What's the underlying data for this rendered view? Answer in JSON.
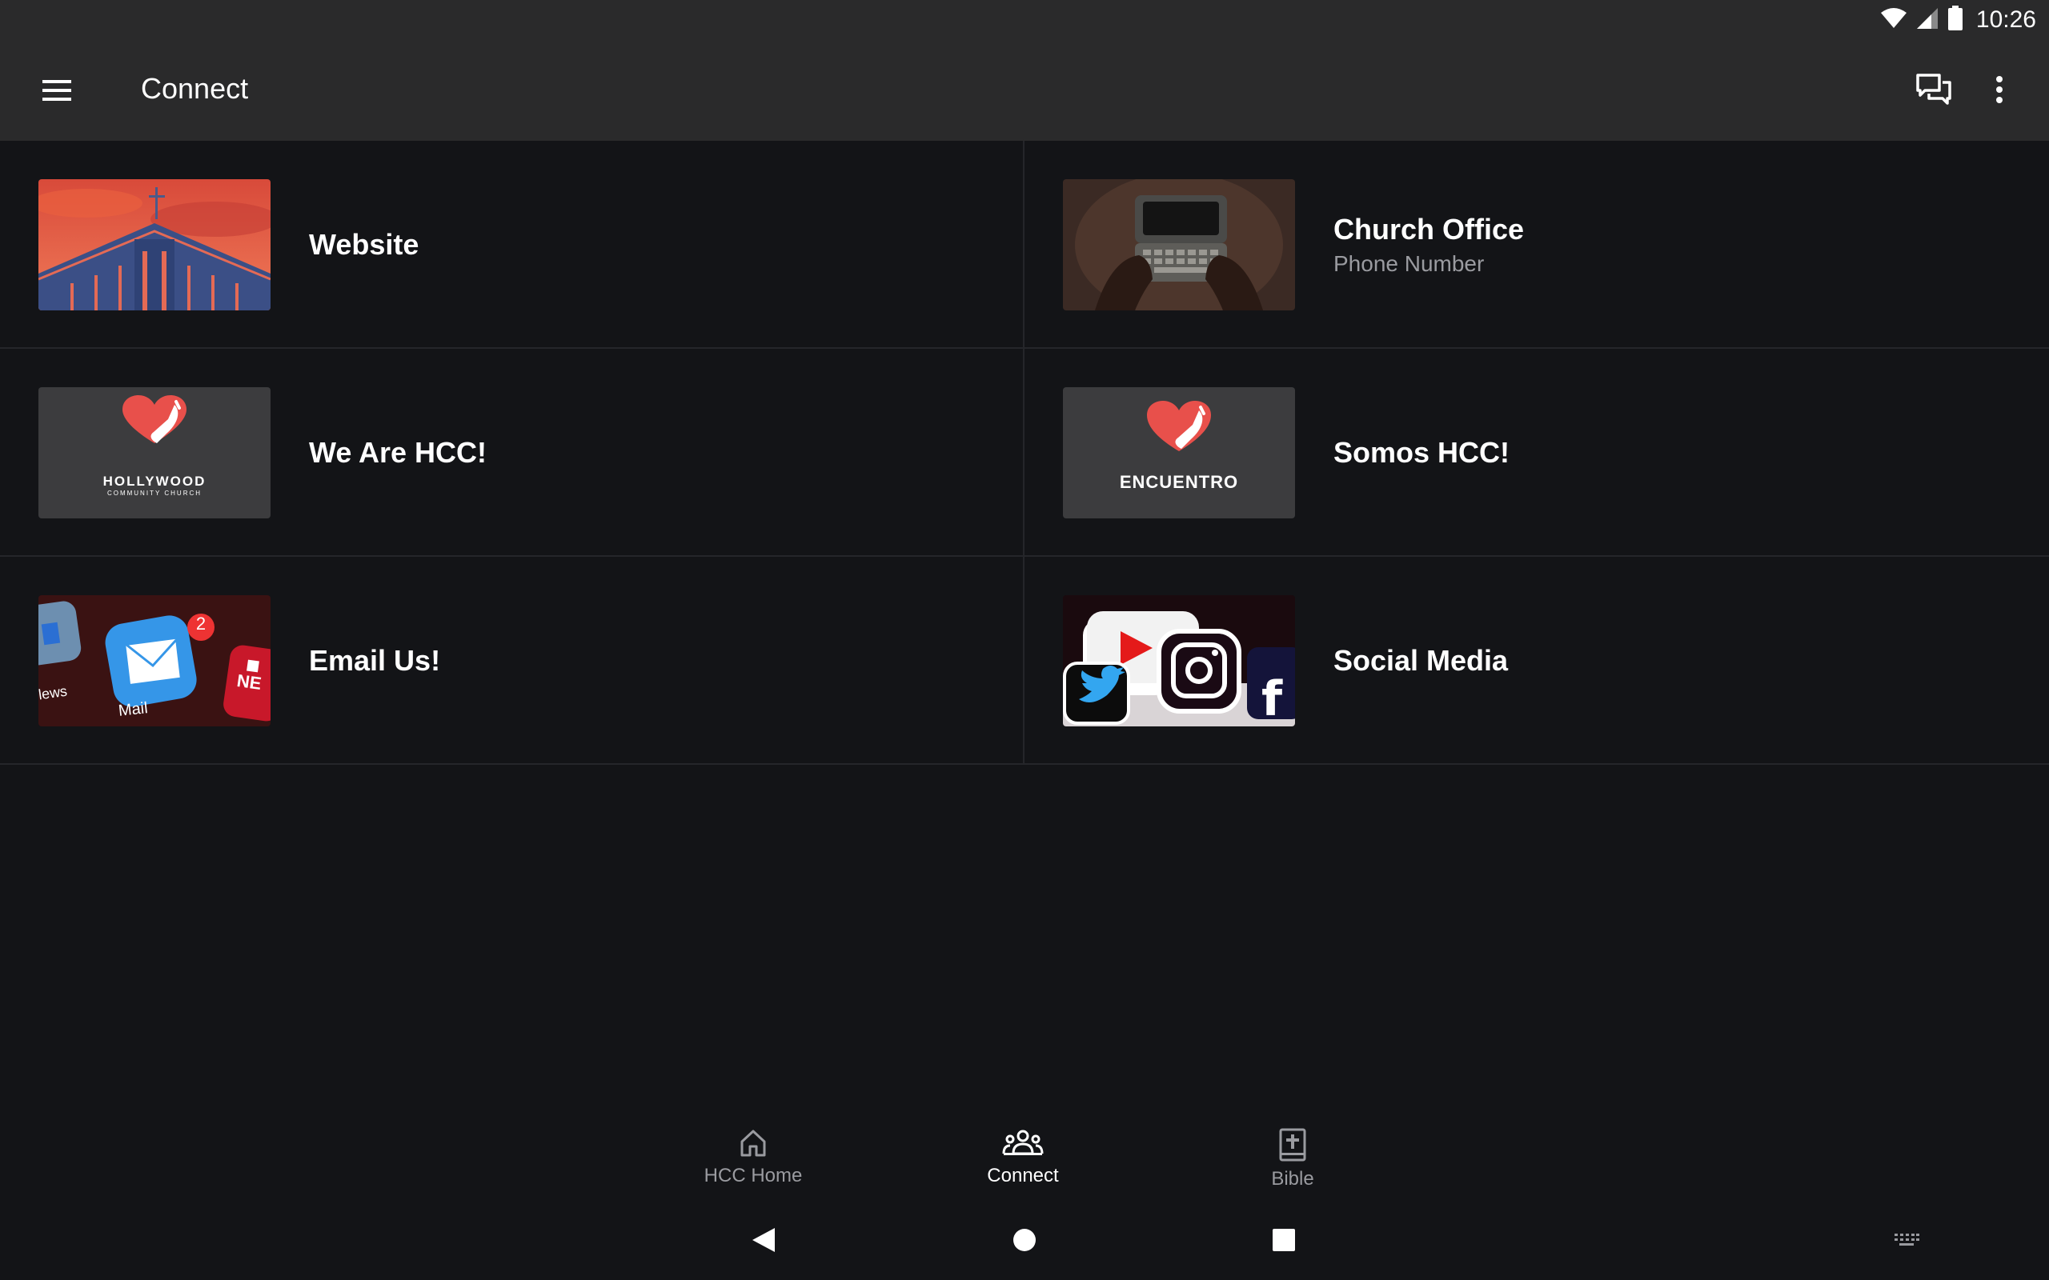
{
  "status_bar": {
    "time": "10:26"
  },
  "app_bar": {
    "title": "Connect"
  },
  "items": [
    {
      "title": "Website",
      "subtitle": ""
    },
    {
      "title": "Church Office",
      "subtitle": "Phone Number"
    },
    {
      "title": "We Are HCC!",
      "subtitle": ""
    },
    {
      "title": "Somos HCC!",
      "subtitle": ""
    },
    {
      "title": "Email Us!",
      "subtitle": ""
    },
    {
      "title": "Social Media",
      "subtitle": ""
    }
  ],
  "thumbs": {
    "hollywood_logo_line1": "HOLLYWOOD",
    "hollywood_logo_line2": "COMMUNITY CHURCH",
    "encuentro_logo": "ENCUENTRO",
    "mail_badge": "2",
    "mail_label": "Mail",
    "news_label": "lews",
    "bbc_label": "NE"
  },
  "bottom_nav": [
    {
      "label": "HCC Home",
      "icon": "home-icon",
      "active": false
    },
    {
      "label": "Connect",
      "icon": "people-icon",
      "active": true
    },
    {
      "label": "Bible",
      "icon": "bible-icon",
      "active": false
    }
  ],
  "colors": {
    "background": "#131417",
    "appbar": "#2a2a2b",
    "accent_red": "#e8504b"
  }
}
